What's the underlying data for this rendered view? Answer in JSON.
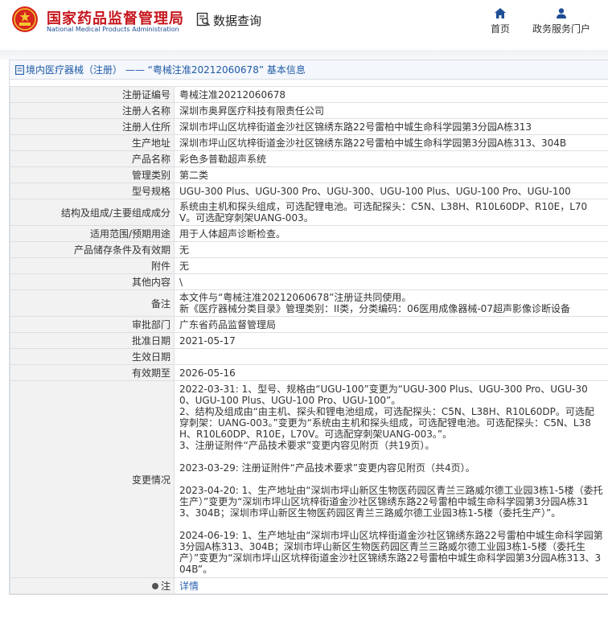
{
  "header": {
    "site_title_cn": "国家药品监督管理局",
    "site_title_en": "National Medical Products Administration",
    "query_label": "数据查询",
    "nav": [
      {
        "label": "首页",
        "icon": "home-icon"
      },
      {
        "label": "政务服务门户",
        "icon": "user-icon"
      }
    ],
    "brand_color": "#c6161d"
  },
  "breadcrumb": "境内医疗器械（注册） —— “粤械注准20212060678” 基本信息",
  "rows": [
    {
      "label": "注册证编号",
      "value": "粤械注准20212060678"
    },
    {
      "label": "注册人名称",
      "value": "深圳市奥昇医疗科技有限责任公司"
    },
    {
      "label": "注册人住所",
      "value": "深圳市坪山区坑梓街道金沙社区锦绣东路22号雷柏中城生命科学园第3分园A栋313"
    },
    {
      "label": "生产地址",
      "value": "深圳市坪山区坑梓街道金沙社区锦绣东路22号雷柏中城生命科学园第3分园A栋313、304B"
    },
    {
      "label": "产品名称",
      "value": "彩色多普勒超声系统"
    },
    {
      "label": "管理类别",
      "value": "第二类"
    },
    {
      "label": "型号规格",
      "value": "UGU-300 Plus、UGU-300 Pro、UGU-300、UGU-100 Plus、UGU-100 Pro、UGU-100"
    },
    {
      "label": "结构及组成/主要组成成分",
      "value": "系统由主机和探头组成，可选配锂电池。可选配探头：C5N、L38H、R10L60DP、R10E，L70V。可选配穿刺架UANG-003。"
    },
    {
      "label": "适用范围/预期用途",
      "value": "用于人体超声诊断检查。"
    },
    {
      "label": "产品储存条件及有效期",
      "value": "无"
    },
    {
      "label": "附件",
      "value": "无"
    },
    {
      "label": "其他内容",
      "value": "\\"
    },
    {
      "label": "备注",
      "value": "本文件与“粤械注准20212060678”注册证共同使用。",
      "value2": "新《医疗器械分类目录》管理类别：II类，分类编码：06医用成像器械-07超声影像诊断设备"
    },
    {
      "label": "审批部门",
      "value": "广东省药品监督管理局"
    },
    {
      "label": "批准日期",
      "value": "2021-05-17"
    },
    {
      "label": "生效日期",
      "value": ""
    },
    {
      "label": "有效期至",
      "value": "2026-05-16"
    }
  ],
  "change": {
    "label": "变更情况",
    "entries": [
      [
        "2022-03-31: 1、型号、规格由“UGU-100”变更为“UGU-300 Plus、UGU-300 Pro、UGU-300、UGU-100 Plus、UGU-100 Pro、UGU-100”。",
        "2、结构及组成由“由主机、探头和锂电池组成，可选配探头：C5N、L38H、R10L60DP。可选配穿刺架：UANG-003。”变更为“系统由主机和探头组成，可选配锂电池。可选配探头：C5N、L38H、R10L60DP、R10E，L70V。可选配穿刺架UANG-003。”。",
        "3、注册证附件“产品技术要求”变更内容见附页（共19页）。"
      ],
      [
        "2023-03-29: 注册证附件“产品技术要求”变更内容见附页（共4页）。"
      ],
      [
        "2023-04-20: 1、生产地址由“深圳市坪山新区生物医药园区青兰三路威尔德工业园3栋1-5楼（委托生产）”变更为“深圳市坪山区坑梓街道金沙社区锦绣东路22号雷柏中城生命科学园第3分园A栋313、304B；深圳市坪山新区生物医药园区青兰三路威尔德工业园3栋1-5楼（委托生产）”。"
      ],
      [
        "2024-06-19: 1、生产地址由“深圳市坪山区坑梓街道金沙社区锦绣东路22号雷柏中城生命科学园第3分园A栋313、304B；深圳市坪山新区生物医药园区青兰三路威尔德工业园3栋1-5楼（委托生产）”变更为“深圳市坪山区坑梓街道金沙社区锦绣东路22号雷柏中城生命科学园第3分园A栋313、304B”。"
      ]
    ]
  },
  "note": {
    "label": "注",
    "link": "详情"
  }
}
